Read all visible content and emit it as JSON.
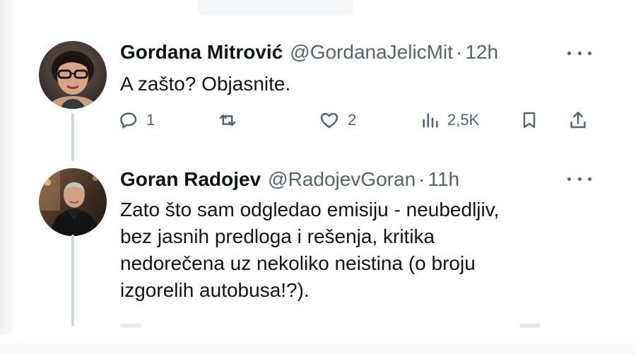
{
  "tweets": [
    {
      "author": {
        "display_name": "Gordana Mitrović",
        "handle": "@GordanaJelicMit",
        "time": "12h"
      },
      "separator": "·",
      "text_lines": [
        "A zašto? Objasnite."
      ],
      "stats": {
        "replies": "1",
        "likes": "2",
        "views": "2,5K"
      },
      "icons": [
        "reply-icon",
        "retweet-icon",
        "like-icon",
        "views-icon",
        "bookmark-icon",
        "share-icon",
        "more-icon"
      ]
    },
    {
      "author": {
        "display_name": "Goran Radojev",
        "handle": "@RadojevGoran",
        "time": "11h"
      },
      "separator": "·",
      "text_lines": [
        "Zato što sam odgledao emisiju - neubedljiv,",
        "bez jasnih predloga i rešenja, kritika",
        "nedorečena uz nekoliko neistina (o broju",
        "izgorelih autobusa!?)."
      ],
      "icons": [
        "more-icon"
      ]
    }
  ],
  "colors": {
    "text_primary": "#0f1419",
    "text_secondary": "#536471",
    "thread_line": "#cfd9de",
    "background": "#ffffff"
  }
}
